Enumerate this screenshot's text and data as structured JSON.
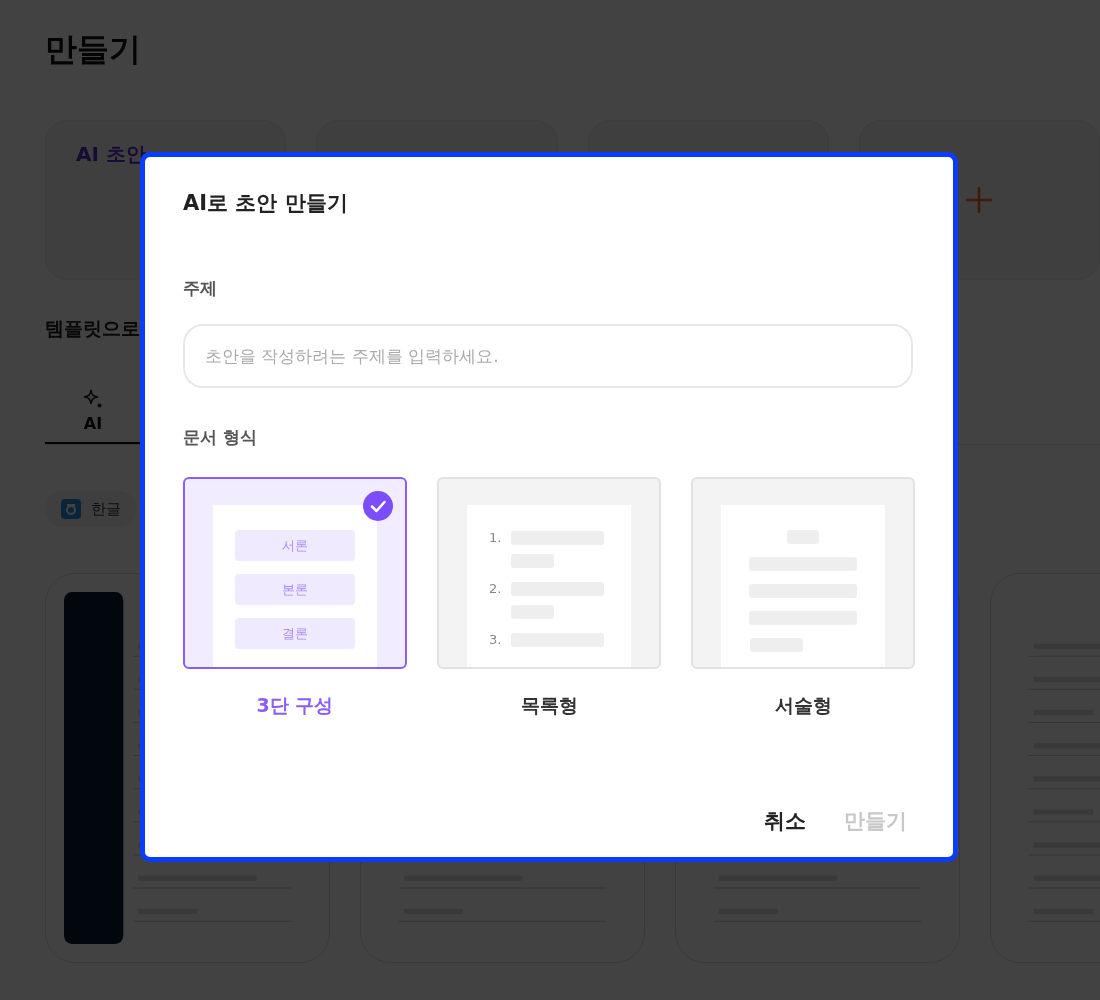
{
  "page": {
    "title": "만들기",
    "create_cards": [
      {
        "kind": "text",
        "label": "AI 초안"
      },
      {
        "kind": "blank"
      },
      {
        "kind": "blank"
      },
      {
        "kind": "add"
      }
    ],
    "section_title": "템플릿으로",
    "tabs": [
      {
        "label": "AI",
        "selected": true
      }
    ],
    "filters": [
      {
        "label": "한글"
      }
    ],
    "templates": [
      {
        "kind": "dark-sidebar"
      },
      {
        "kind": "plain"
      },
      {
        "kind": "plain"
      },
      {
        "kind": "plain"
      }
    ]
  },
  "dialog": {
    "title": "AI로 초안 만들기",
    "topic_label": "주제",
    "topic_field": {
      "placeholder": "초안을 작성하려는 주제를 입력하세요."
    },
    "format_label": "문서 형식",
    "format_options": [
      {
        "kind": "outline",
        "label": "3단 구성",
        "selected": true,
        "preview_items": [
          "서론",
          "본론",
          "결론"
        ]
      },
      {
        "kind": "list",
        "label": "목록형",
        "selected": false,
        "preview_items": [
          "1.",
          "2.",
          "3."
        ]
      },
      {
        "kind": "prose",
        "label": "서술형",
        "selected": false
      }
    ],
    "buttons": [
      {
        "label": "취소",
        "disabled": false
      },
      {
        "label": "만들기",
        "disabled": true
      }
    ]
  }
}
